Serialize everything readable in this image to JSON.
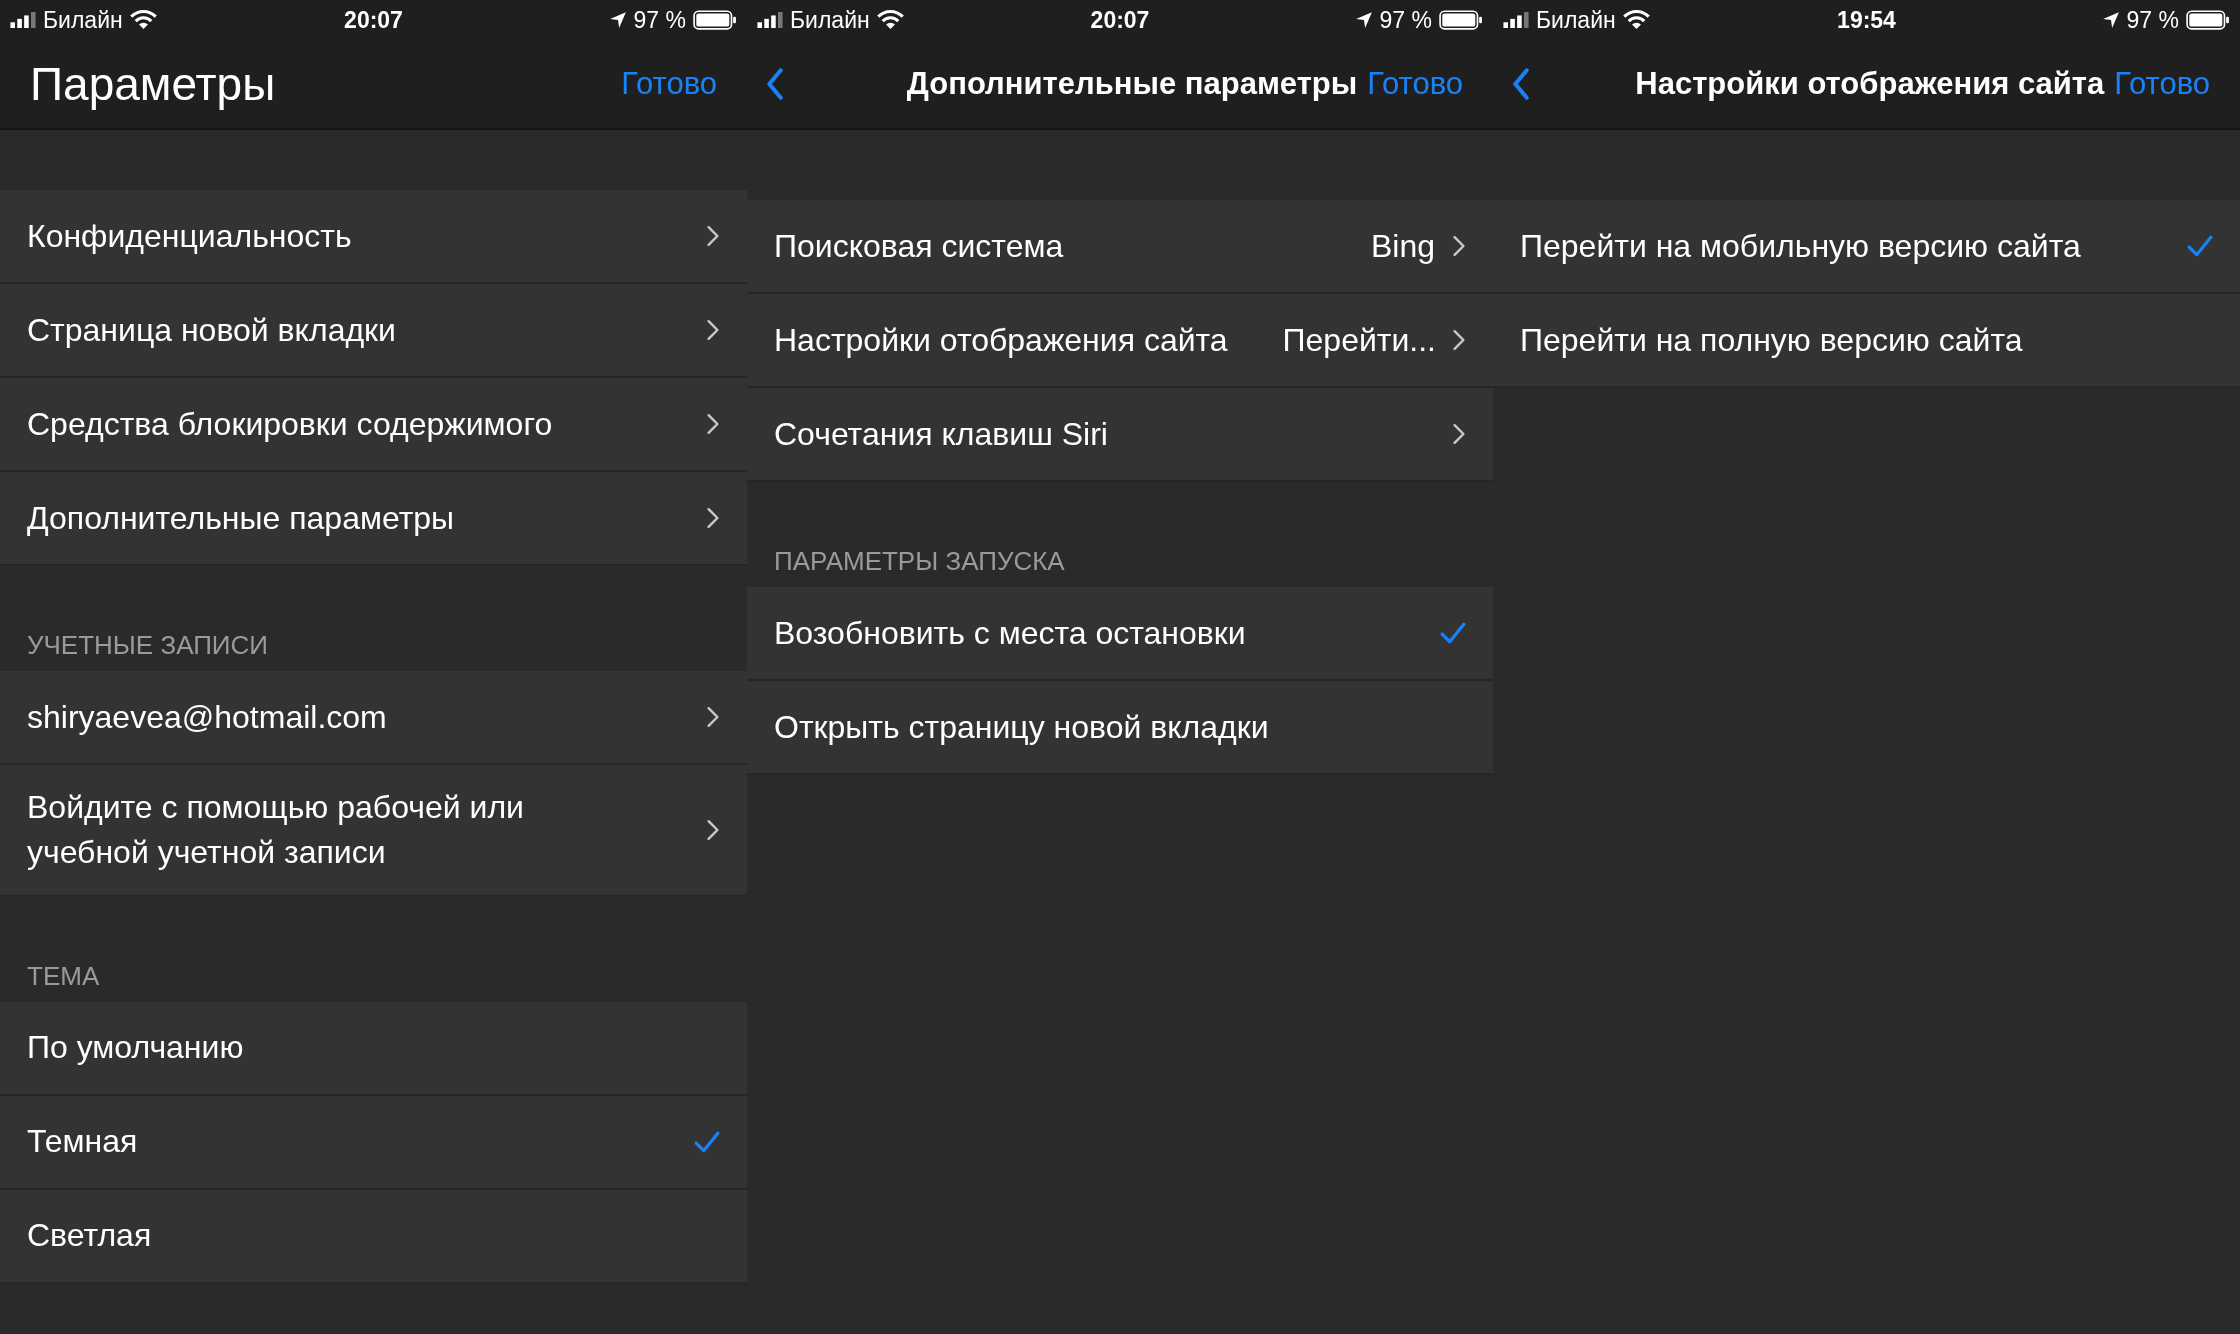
{
  "panels": [
    {
      "status_bar": {
        "carrier": "Билайн",
        "time": "20:07",
        "battery": "97 %"
      },
      "nav": {
        "kind": "large",
        "title": "Параметры",
        "done": "Готово"
      },
      "sections": [
        {
          "rows": [
            {
              "kind": "disclosure",
              "label": "Конфиденциальность"
            },
            {
              "kind": "disclosure",
              "label": "Страница новой вкладки"
            },
            {
              "kind": "disclosure",
              "label": "Средства блокировки содержимого"
            },
            {
              "kind": "disclosure",
              "label": "Дополнительные параметры"
            }
          ]
        },
        {
          "header": "УЧЕТНЫЕ ЗАПИСИ",
          "rows": [
            {
              "kind": "disclosure",
              "label": "shiryaevea@hotmail.com"
            },
            {
              "kind": "disclosure",
              "label": "Войдите с помощью рабочей или учебной учетной записи"
            }
          ]
        },
        {
          "header": "ТЕМА",
          "rows": [
            {
              "kind": "choice",
              "label": "По умолчанию",
              "selected": false
            },
            {
              "kind": "choice",
              "label": "Темная",
              "selected": true
            },
            {
              "kind": "choice",
              "label": "Светлая",
              "selected": false
            }
          ]
        }
      ]
    },
    {
      "status_bar": {
        "carrier": "Билайн",
        "time": "20:07",
        "battery": "97 %"
      },
      "nav": {
        "kind": "inline",
        "title": "Дополнительные параметры",
        "done": "Готово"
      },
      "sections": [
        {
          "rows": [
            {
              "kind": "disclosure",
              "label": "Поисковая система",
              "value": "Bing"
            },
            {
              "kind": "disclosure",
              "label": "Настройки отображения сайта",
              "value": "Перейти..."
            },
            {
              "kind": "disclosure",
              "label": "Сочетания клавиш Siri"
            }
          ]
        },
        {
          "header": "ПАРАМЕТРЫ ЗАПУСКА",
          "rows": [
            {
              "kind": "choice",
              "label": "Возобновить с места остановки",
              "selected": true
            },
            {
              "kind": "choice",
              "label": "Открыть страницу новой вкладки",
              "selected": false
            }
          ]
        }
      ]
    },
    {
      "status_bar": {
        "carrier": "Билайн",
        "time": "19:54",
        "battery": "97 %"
      },
      "nav": {
        "kind": "inline",
        "title": "Настройки отображения сайта",
        "done": "Готово"
      },
      "sections": [
        {
          "rows": [
            {
              "kind": "choice",
              "label": "Перейти на мобильную версию сайта",
              "selected": true
            },
            {
              "kind": "choice",
              "label": "Перейти на полную версию сайта",
              "selected": false
            }
          ]
        }
      ]
    }
  ]
}
